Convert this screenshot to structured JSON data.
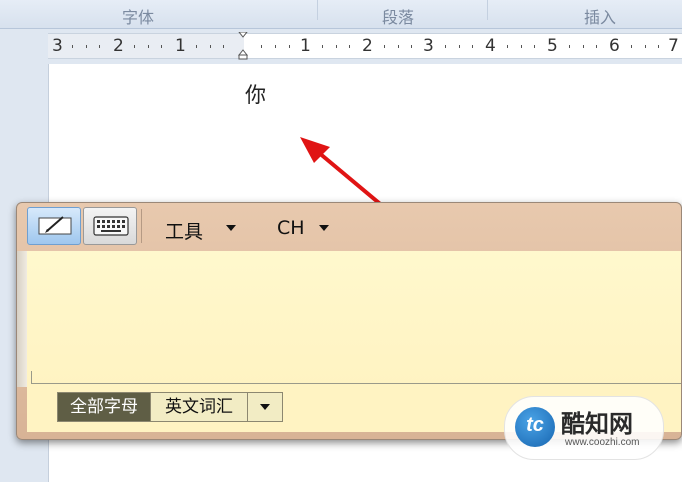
{
  "ribbon": {
    "groups": [
      "字体",
      "段落",
      "插入"
    ]
  },
  "ruler": {
    "labels": [
      "3",
      "2",
      "1",
      "1",
      "2",
      "3",
      "4",
      "5",
      "6",
      "7"
    ]
  },
  "document": {
    "text": "你"
  },
  "ime_panel": {
    "pen_mode_icon": "pen-icon",
    "keyboard_mode_icon": "keyboard-icon",
    "tools_menu": "工具",
    "lang_menu": "CH",
    "tabs": {
      "all_letters": "全部字母",
      "english_vocab": "英文词汇"
    }
  },
  "watermark": {
    "badge": "tc",
    "name": "酷知网",
    "url": "www.coozhi.com"
  },
  "colors": {
    "arrow": "#e01414",
    "active_tab": "#5f5e45",
    "writing_area": "#fff6c8"
  }
}
